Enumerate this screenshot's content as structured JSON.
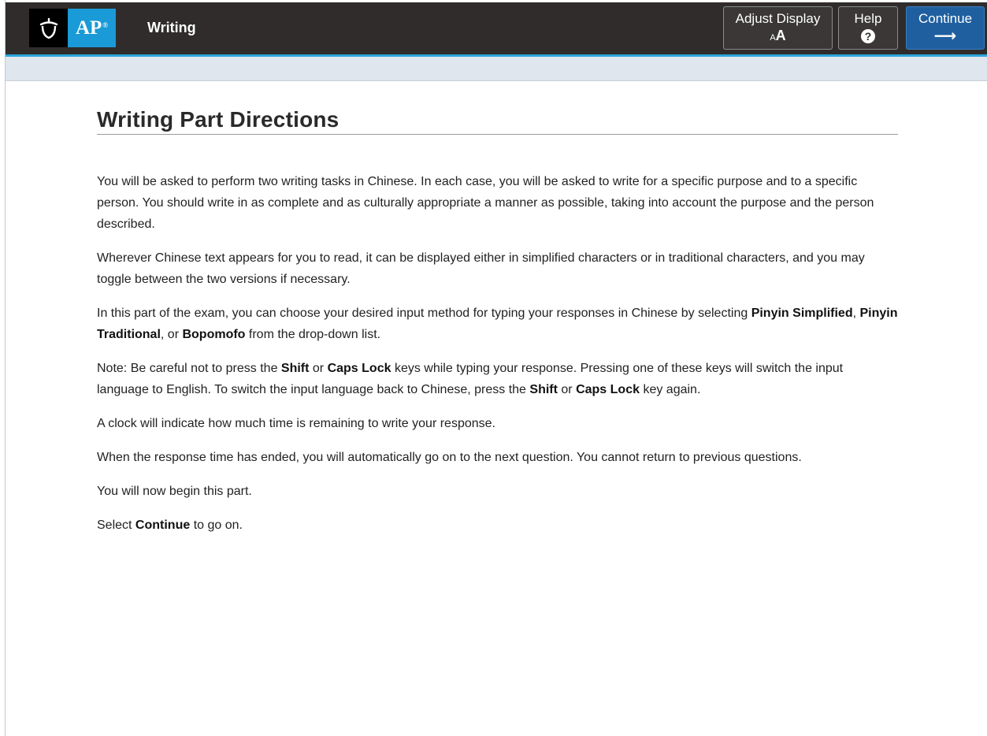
{
  "header": {
    "section_title": "Writing",
    "logo_text": "AP",
    "logo_sup": "®",
    "buttons": {
      "adjust_display_label": "Adjust Display",
      "adjust_display_icon_text": "AA",
      "help_label": "Help",
      "help_icon_text": "?",
      "continue_label": "Continue",
      "continue_icon_text": "⟶"
    }
  },
  "page": {
    "title": "Writing Part Directions",
    "paragraphs": [
      {
        "text": "You will be asked to perform two writing tasks in Chinese. In each case, you will be asked to write for a specific purpose and to a specific person. You should write in as complete and as culturally appropriate a manner as possible, taking into account the purpose and the person described."
      },
      {
        "text": "Wherever Chinese text appears for you to read, it can be displayed either in simplified characters or in traditional characters, and you may toggle between the two versions if necessary."
      },
      {
        "t1": "In this part of the exam, you can choose your desired input method for typing your responses in Chinese by selecting ",
        "b1": "Pinyin Simplified",
        "t2": ", ",
        "b2": "Pinyin Traditional",
        "t3": ", or ",
        "b3": "Bopomofo",
        "t4": " from the drop-down list."
      },
      {
        "t1": "Note: Be careful not to press the ",
        "b1": "Shift",
        "t2": " or ",
        "b2": "Caps Lock",
        "t3": " keys while typing your response. Pressing one of these keys will switch the input language to English. To switch the input language back to Chinese, press the ",
        "b3": "Shift",
        "t4": " or ",
        "b4": "Caps Lock",
        "t5": " key again."
      },
      {
        "text": "A clock will indicate how much time is remaining to write your response."
      },
      {
        "text": "When the response time has ended, you will automatically go on to the next question. You cannot return to previous questions."
      },
      {
        "text": "You will now begin this part."
      },
      {
        "t1": "Select ",
        "b1": "Continue",
        "t2": " to go on."
      }
    ]
  },
  "colors": {
    "topbar_bg": "#2f2c2b",
    "accent_blue": "#1a9ad6",
    "continue_bg": "#1f5f9f",
    "subbar_bg": "#dfe6ee"
  }
}
